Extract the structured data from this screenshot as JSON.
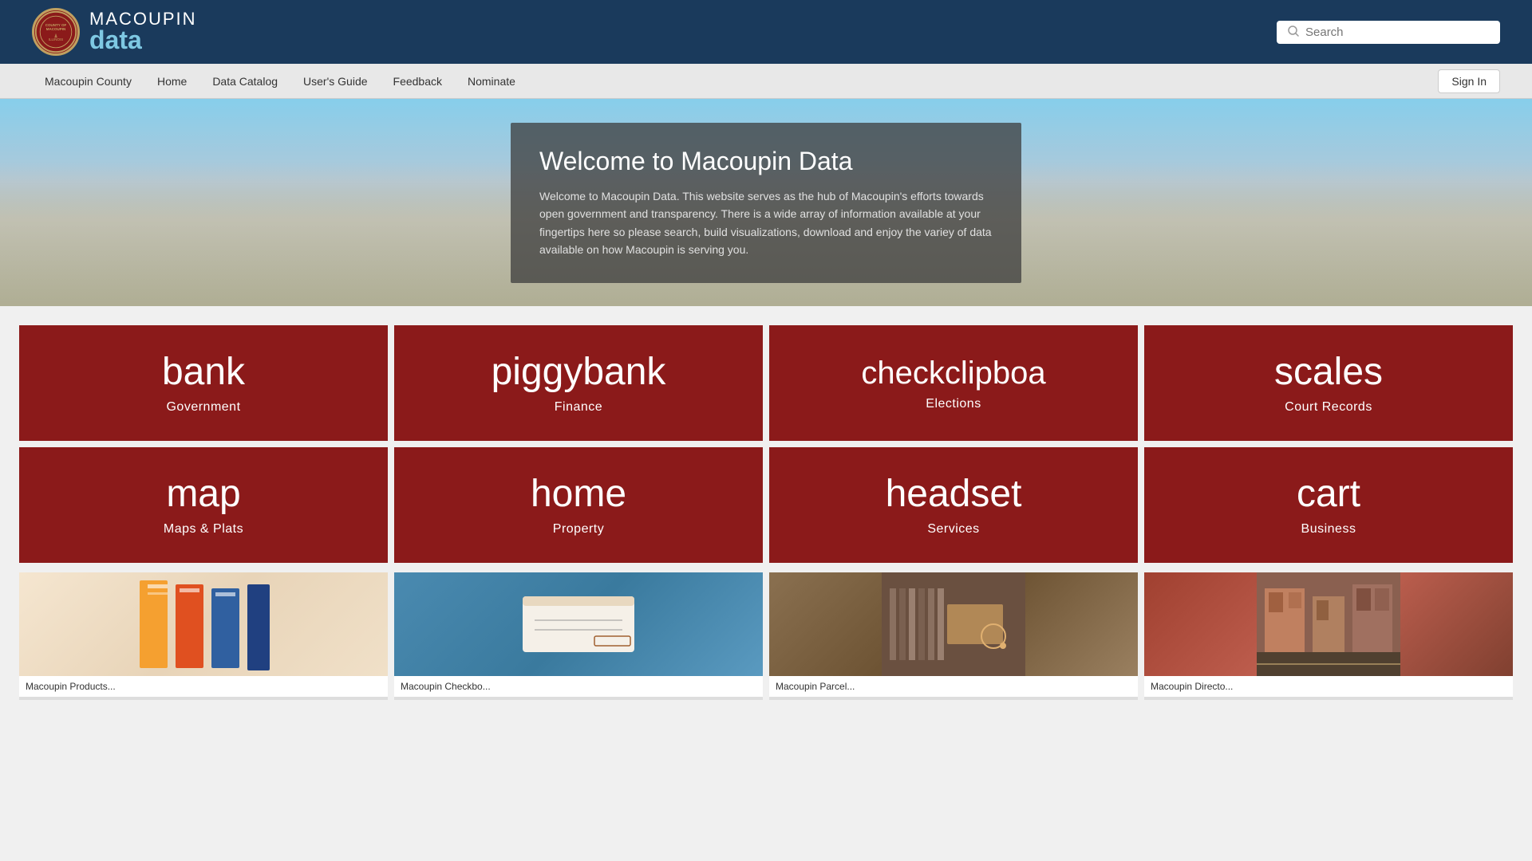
{
  "header": {
    "logo_macoupin": "MACOUPIN",
    "logo_data": "data",
    "logo_alt": "Macoupin County Illinois seal"
  },
  "search": {
    "placeholder": "Search"
  },
  "nav": {
    "links": [
      {
        "label": "Macoupin County",
        "id": "macoupin-county"
      },
      {
        "label": "Home",
        "id": "home"
      },
      {
        "label": "Data Catalog",
        "id": "data-catalog"
      },
      {
        "label": "User's Guide",
        "id": "users-guide"
      },
      {
        "label": "Feedback",
        "id": "feedback"
      },
      {
        "label": "Nominate",
        "id": "nominate"
      }
    ],
    "sign_in": "Sign In"
  },
  "hero": {
    "title": "Welcome to Macoupin Data",
    "description": "Welcome to Macoupin Data. This website serves as the hub of Macoupin's efforts towards open government and transparency. There is a wide array of information available at your fingertips here so please search, build visualizations, download and enjoy the variey of data available on how Macoupin is serving you."
  },
  "categories_row1": [
    {
      "icon": "bank",
      "label": "Government",
      "id": "government"
    },
    {
      "icon": "piggybank",
      "label": "Finance",
      "id": "finance"
    },
    {
      "icon": "checkclipboard",
      "label": "Elections",
      "id": "elections"
    },
    {
      "icon": "scales",
      "label": "Court Records",
      "id": "court-records"
    }
  ],
  "categories_row2": [
    {
      "icon": "map",
      "label": "Maps & Plats",
      "id": "maps-plats"
    },
    {
      "icon": "home",
      "label": "Property",
      "id": "property"
    },
    {
      "icon": "headset",
      "label": "Services",
      "id": "services"
    },
    {
      "icon": "cart",
      "label": "Business",
      "id": "business"
    }
  ],
  "thumbnails": [
    {
      "title": "Macoupin Products...",
      "theme": "brochures"
    },
    {
      "title": "Macoupin Checkbo...",
      "theme": "check"
    },
    {
      "title": "Macoupin Parcel...",
      "theme": "library"
    },
    {
      "title": "Macoupin Directo...",
      "theme": "street"
    }
  ]
}
